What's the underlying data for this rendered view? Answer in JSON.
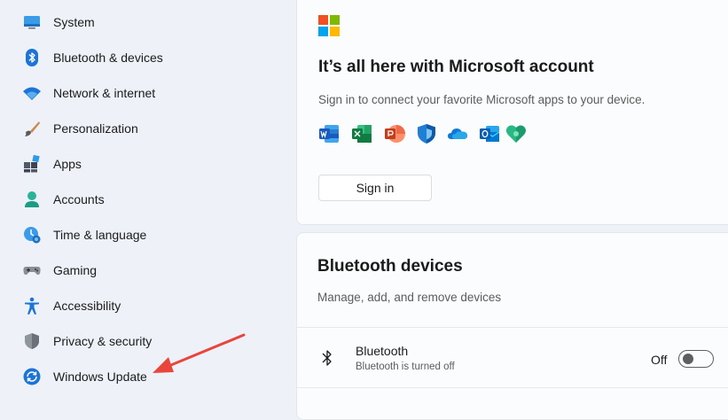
{
  "sidebar": {
    "items": [
      {
        "label": "System",
        "icon": "system-icon"
      },
      {
        "label": "Bluetooth & devices",
        "icon": "bluetooth-icon"
      },
      {
        "label": "Network & internet",
        "icon": "wifi-icon"
      },
      {
        "label": "Personalization",
        "icon": "brush-icon"
      },
      {
        "label": "Apps",
        "icon": "apps-icon"
      },
      {
        "label": "Accounts",
        "icon": "account-icon"
      },
      {
        "label": "Time & language",
        "icon": "clock-globe-icon"
      },
      {
        "label": "Gaming",
        "icon": "gamepad-icon"
      },
      {
        "label": "Accessibility",
        "icon": "accessibility-icon"
      },
      {
        "label": "Privacy & security",
        "icon": "shield-icon"
      },
      {
        "label": "Windows Update",
        "icon": "windows-update-icon"
      }
    ]
  },
  "microsoft_card": {
    "title": "It’s all here with Microsoft account",
    "subtitle": "Sign in to connect your favorite Microsoft apps to your device.",
    "apps": [
      "word-icon",
      "excel-icon",
      "powerpoint-icon",
      "defender-icon",
      "onedrive-icon",
      "outlook-icon",
      "family-icon"
    ],
    "signin_label": "Sign in"
  },
  "bluetooth_card": {
    "title": "Bluetooth devices",
    "subtitle": "Manage, add, and remove devices",
    "row_name": "Bluetooth",
    "row_status": "Bluetooth is turned off",
    "state_label": "Off",
    "enabled": false
  },
  "colors": {
    "accent": "#0067c0",
    "annotation_arrow": "#e8453c",
    "ms_red": "#f25022",
    "ms_green": "#7fba00",
    "ms_blue": "#00a4ef",
    "ms_yellow": "#ffb900"
  }
}
